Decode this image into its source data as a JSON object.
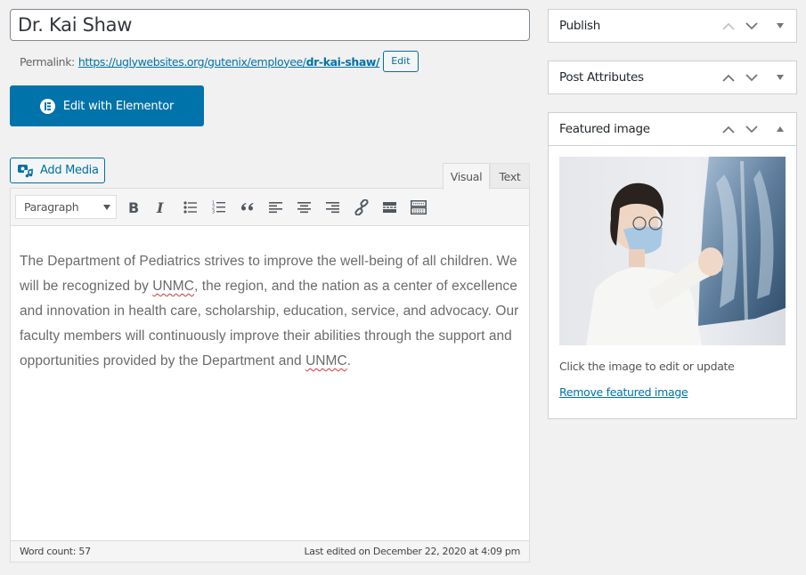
{
  "post": {
    "title": "Dr. Kai Shaw",
    "permalink_label": "Permalink:",
    "permalink_base": "https://uglywebsites.org/gutenix/employee/",
    "permalink_slug": "dr-kai-shaw/",
    "permalink_edit_label": "Edit"
  },
  "elementor": {
    "label": "Edit with Elementor",
    "icon": "elementor-icon"
  },
  "media": {
    "add_media_label": "Add Media",
    "icon": "media-icon"
  },
  "editor": {
    "tabs": [
      {
        "label": "Visual",
        "active": true
      },
      {
        "label": "Text",
        "active": false
      }
    ],
    "toolbar": {
      "format_selected": "Paragraph",
      "buttons": [
        {
          "name": "bold",
          "icon": "bold-icon"
        },
        {
          "name": "italic",
          "icon": "italic-icon"
        },
        {
          "name": "bulleted-list",
          "icon": "bullet-list-icon"
        },
        {
          "name": "numbered-list",
          "icon": "numbered-list-icon"
        },
        {
          "name": "blockquote",
          "icon": "blockquote-icon"
        },
        {
          "name": "align-left",
          "icon": "align-left-icon"
        },
        {
          "name": "align-center",
          "icon": "align-center-icon"
        },
        {
          "name": "align-right",
          "icon": "align-right-icon"
        },
        {
          "name": "insert-link",
          "icon": "link-icon"
        },
        {
          "name": "read-more",
          "icon": "read-more-icon"
        },
        {
          "name": "toolbar-toggle",
          "icon": "keyboard-icon"
        }
      ]
    },
    "content": {
      "part1": "The Department of Pediatrics strives to improve the well-being of all children. We will be recognized by ",
      "misspelled1": "UNMC",
      "part2": ", the region, and the nation as a center of excellence and innovation in health care, scholarship, education, service, and advocacy. Our faculty members will continuously improve their abilities through the support and opportunities provided by the Department and ",
      "misspelled2": "UNMC",
      "part3": "."
    },
    "word_count": "Word count: 57",
    "last_edited": "Last edited on December 22, 2020 at 4:09 pm"
  },
  "sidebar": {
    "publish": {
      "title": "Publish",
      "expanded": false
    },
    "post_attributes": {
      "title": "Post Attributes",
      "expanded": false
    },
    "featured_image": {
      "title": "Featured image",
      "expanded": true,
      "image_alt": "Doctor in face mask examining a chest X-ray",
      "hint": "Click the image to edit or update",
      "remove_label": "Remove featured image"
    }
  },
  "colors": {
    "accent": "#0073aa",
    "background": "#f1f1f1",
    "spellcheck": "#d63638"
  }
}
